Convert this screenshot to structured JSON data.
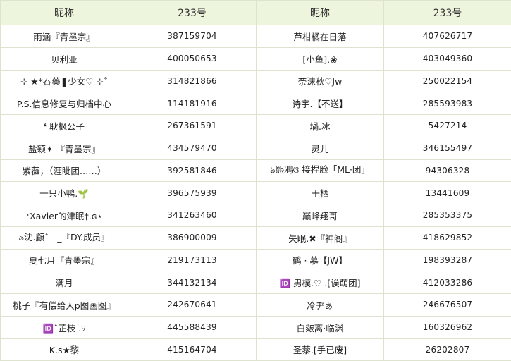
{
  "headers": [
    "昵称",
    "233号",
    "昵称",
    "233号"
  ],
  "rows": [
    [
      "雨涵『青墨宗』",
      "387159704",
      "芦柑橘在日落",
      "407626717"
    ],
    [
      "贝利亚",
      "400050653",
      "[小鱼].❀",
      "403049360"
    ],
    [
      "⊹ ★*吞藥❚少女♡ ⊹˚",
      "314821866",
      "奈沫秋♡Jw",
      "250022154"
    ],
    [
      "P.S.信息修复与归档中心",
      "114181916",
      "诗宇.【不送】",
      "285593983"
    ],
    [
      "❛ 耿枫公子",
      "267361591",
      "堝.冰",
      "5427214"
    ],
    [
      "盐颖✦ 『青墨宗』",
      "434579470",
      "灵儿",
      "346155497"
    ],
    [
      "紫薇，（涯眦团……）",
      "392581846",
      "ঌ熙鸦ଓ 接捏脸「ML·团」",
      "94306328"
    ],
    [
      "一只小鸭.🌱",
      "396575939",
      "于栖",
      "13441609"
    ],
    [
      "ˣXavier的津眠†.ɢ⋆",
      "341263460",
      "巅峰翔哥",
      "285353375"
    ],
    [
      "ঌ沈.顧ˆ ̶ ̶ _『DY.成员』",
      "386900009",
      "失眠.✖『神阁』",
      "418629852"
    ],
    [
      "夏七月『青墨宗』",
      "219173113",
      "鹤 · 慕【JW】",
      "198393287"
    ],
    [
      "满月",
      "344132134",
      "🆔 男模.♡ .[诶萌团]",
      "412033286"
    ],
    [
      "桃子『有偿给人p图画图』",
      "242670641",
      "冷ヂぁ",
      "246676507"
    ],
    [
      "🆔ˆ芷枝 .୨",
      "445588439",
      "白皴离·临渊",
      "160326962"
    ],
    [
      "K.s★黎",
      "415164704",
      "圣藜.[手已废]",
      "26202807"
    ]
  ]
}
